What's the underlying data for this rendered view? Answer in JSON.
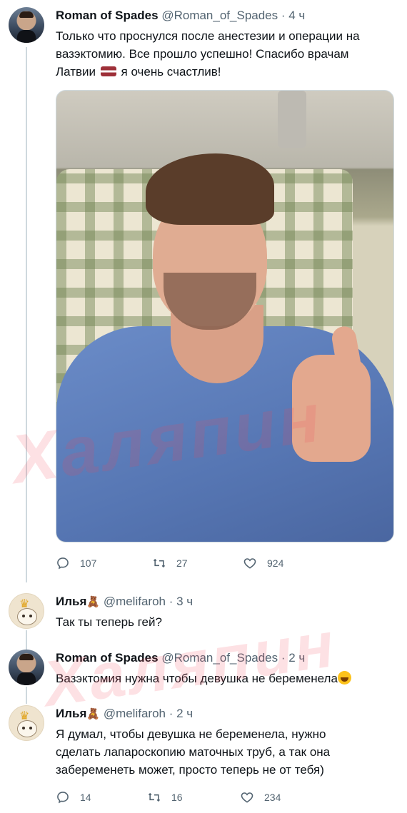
{
  "tweets": [
    {
      "name": "Roman of Spades",
      "handle": "@Roman_of_Spades",
      "time": "· 4 ч",
      "text_a": "Только что проснулся после анестезии и операции на вазэктомию. Все прошло успешно! Спасибо врачам Латвии",
      "text_b": "я очень счастлив!",
      "replies": "107",
      "retweets": "27",
      "likes": "924"
    },
    {
      "name": "Илья",
      "handle": "@melifaroh",
      "time": "· 3 ч",
      "text": "Так ты теперь гей?"
    },
    {
      "name": "Roman of Spades",
      "handle": "@Roman_of_Spades",
      "time": "· 2 ч",
      "text": "Вазэктомия нужна чтобы девушка не беременела"
    },
    {
      "name": "Илья",
      "handle": "@melifaroh",
      "time": "· 2 ч",
      "text": "Я думал, чтобы девушка не беременела, нужно сделать лапароскопию маточных труб, а так она забеременеть может, просто теперь не от тебя)",
      "replies": "14",
      "retweets": "16",
      "likes": "234"
    }
  ],
  "watermark": "Халяпин",
  "colors": {
    "text": "#0f1419",
    "secondary": "#536471",
    "thread": "#cfd9de",
    "watermark": "#f0465a"
  },
  "icons": [
    "reply-icon",
    "retweet-icon",
    "like-icon",
    "latvia-flag-emoji",
    "teddy-bear-emoji",
    "tears-of-joy-emoji"
  ]
}
